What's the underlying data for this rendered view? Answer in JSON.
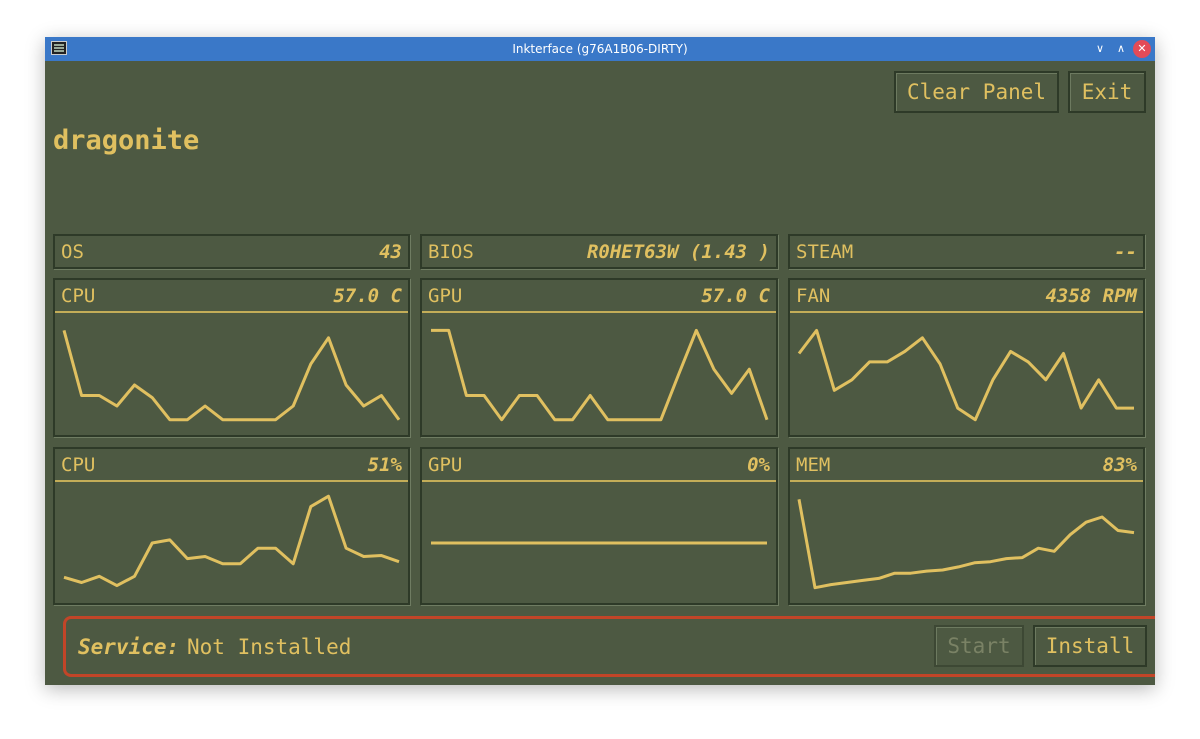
{
  "window": {
    "title": "Inkterface (g76A1B06-DIRTY)"
  },
  "titlebar": {
    "minimize_glyph": "∨",
    "maximize_glyph": "∧",
    "close_glyph": "✕"
  },
  "toolbar": {
    "clear_label": "Clear Panel",
    "exit_label": "Exit"
  },
  "hostname": "dragonite",
  "info": [
    {
      "label": "OS",
      "value": "43"
    },
    {
      "label": "BIOS",
      "value": "R0HET63W (1.43 )"
    },
    {
      "label": "STEAM",
      "value": "--"
    }
  ],
  "graphs": [
    {
      "label": "CPU",
      "value": "57.0 C",
      "points": [
        0.92,
        0.3,
        0.3,
        0.2,
        0.4,
        0.28,
        0.07,
        0.07,
        0.2,
        0.07,
        0.07,
        0.07,
        0.07,
        0.2,
        0.6,
        0.85,
        0.4,
        0.2,
        0.3,
        0.07
      ]
    },
    {
      "label": "GPU",
      "value": "57.0 C",
      "points": [
        0.92,
        0.92,
        0.3,
        0.3,
        0.07,
        0.3,
        0.3,
        0.07,
        0.07,
        0.3,
        0.07,
        0.07,
        0.07,
        0.07,
        0.5,
        0.92,
        0.55,
        0.32,
        0.55,
        0.07
      ]
    },
    {
      "label": "FAN",
      "value": "4358 RPM",
      "points": [
        0.7,
        0.92,
        0.35,
        0.45,
        0.62,
        0.62,
        0.72,
        0.85,
        0.6,
        0.18,
        0.07,
        0.45,
        0.72,
        0.62,
        0.45,
        0.7,
        0.18,
        0.45,
        0.18,
        0.18
      ]
    },
    {
      "label": "CPU",
      "value": "51%",
      "points": [
        0.17,
        0.12,
        0.18,
        0.09,
        0.18,
        0.5,
        0.53,
        0.35,
        0.37,
        0.3,
        0.3,
        0.45,
        0.45,
        0.3,
        0.85,
        0.95,
        0.45,
        0.37,
        0.38,
        0.32
      ]
    },
    {
      "label": "GPU",
      "value": "0%",
      "points": [
        0.5,
        0.5,
        0.5,
        0.5,
        0.5,
        0.5,
        0.5,
        0.5,
        0.5,
        0.5,
        0.5,
        0.5,
        0.5,
        0.5,
        0.5,
        0.5,
        0.5,
        0.5,
        0.5,
        0.5
      ]
    },
    {
      "label": "MEM",
      "value": "83%",
      "points": [
        0.92,
        0.07,
        0.1,
        0.12,
        0.14,
        0.16,
        0.21,
        0.21,
        0.23,
        0.24,
        0.27,
        0.31,
        0.32,
        0.35,
        0.36,
        0.45,
        0.42,
        0.58,
        0.7,
        0.75,
        0.62,
        0.6
      ]
    }
  ],
  "service": {
    "label": "Service:",
    "status": "Not Installed",
    "start_label": "Start",
    "install_label": "Install"
  },
  "colors": {
    "background": "#4d5942",
    "accent": "#e0c060",
    "border": "#2e3a28",
    "service_border": "#c24528",
    "titlebar": "#3a78c8"
  }
}
